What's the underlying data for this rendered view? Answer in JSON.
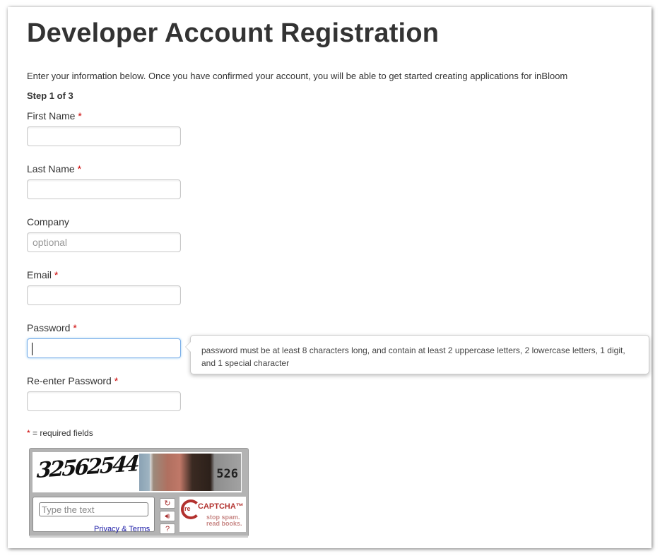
{
  "page": {
    "title": "Developer Account Registration",
    "intro": "Enter your information below. Once you have confirmed your account, you will be able to get started creating applications for inBloom",
    "step": "Step 1 of 3"
  },
  "form": {
    "required_marker": "*",
    "fields": [
      {
        "label": "First Name",
        "required": true,
        "value": "",
        "placeholder": ""
      },
      {
        "label": "Last Name",
        "required": true,
        "value": "",
        "placeholder": ""
      },
      {
        "label": "Company",
        "required": false,
        "value": "",
        "placeholder": "optional"
      },
      {
        "label": "Email",
        "required": true,
        "value": "",
        "placeholder": ""
      },
      {
        "label": "Password",
        "required": true,
        "value": "",
        "placeholder": "",
        "focused": true
      },
      {
        "label": "Re-enter Password",
        "required": true,
        "value": "",
        "placeholder": ""
      }
    ],
    "password_hint": "password must be at least 8 characters long, and contain at least 2 uppercase letters, 2 lowercase letters, 1 digit, and 1 special character",
    "required_note": "= required fields"
  },
  "recaptcha": {
    "challenge_word": "32562544",
    "house_number": "526",
    "input_placeholder": "Type the text",
    "privacy_link": "Privacy & Terms",
    "buttons": [
      "refresh-icon",
      "audio-icon",
      "help-icon"
    ],
    "logo_prefix": "re",
    "logo_name": "CAPTCHA™",
    "tagline_1": "stop spam.",
    "tagline_2": "read books.",
    "brand_color": "#b2312e"
  }
}
